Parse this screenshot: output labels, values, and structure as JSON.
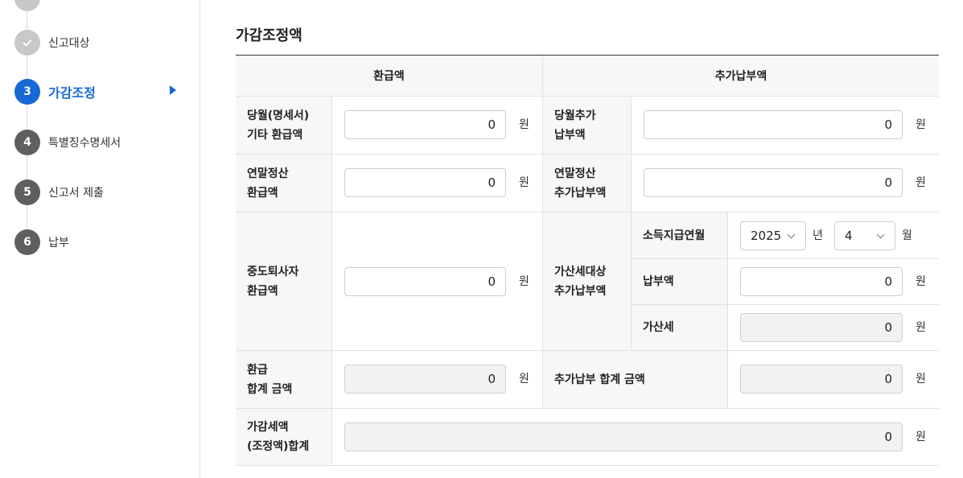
{
  "sidebar": {
    "steps": [
      {
        "label": "신고대상",
        "number": "✓",
        "state": "done"
      },
      {
        "label": "가감조정",
        "number": "3",
        "state": "active"
      },
      {
        "label": "특별징수명세서",
        "number": "4",
        "state": "todo"
      },
      {
        "label": "신고서 제출",
        "number": "5",
        "state": "todo"
      },
      {
        "label": "납부",
        "number": "6",
        "state": "todo"
      }
    ]
  },
  "section": {
    "title": "가감조정액"
  },
  "table": {
    "header_refund": "환급액",
    "header_additional": "추가납부액",
    "unit_won": "원",
    "rows": {
      "monthly_refund": {
        "label_line1": "당월(명세서)",
        "label_line2": "기타 환급액",
        "value": "0"
      },
      "monthly_add": {
        "label_line1": "당월추가",
        "label_line2": "납부액",
        "value": "0"
      },
      "yearend_refund": {
        "label_line1": "연말정산",
        "label_line2": "환급액",
        "value": "0"
      },
      "yearend_add": {
        "label_line1": "연말정산",
        "label_line2": "추가납부액",
        "value": "0"
      },
      "midretire_refund": {
        "label_line1": "중도퇴사자",
        "label_line2": "환급액",
        "value": "0"
      },
      "penalty_target": {
        "label_line1": "가산세대상",
        "label_line2": "추가납부액"
      },
      "income_month": {
        "label": "소득지급연월",
        "year": "2025",
        "year_unit": "년",
        "month": "4",
        "month_unit": "월"
      },
      "payment": {
        "label": "납부액",
        "value": "0"
      },
      "penalty_tax": {
        "label": "가산세",
        "value": "0"
      },
      "refund_total": {
        "label_line1": "환급",
        "label_line2": "합계 금액",
        "value": "0"
      },
      "additional_total": {
        "label": "추가납부 합계 금액",
        "value": "0"
      },
      "adjusted_total": {
        "label_line1": "가감세액",
        "label_line2": "(조정액)합계",
        "value": "0"
      }
    }
  }
}
